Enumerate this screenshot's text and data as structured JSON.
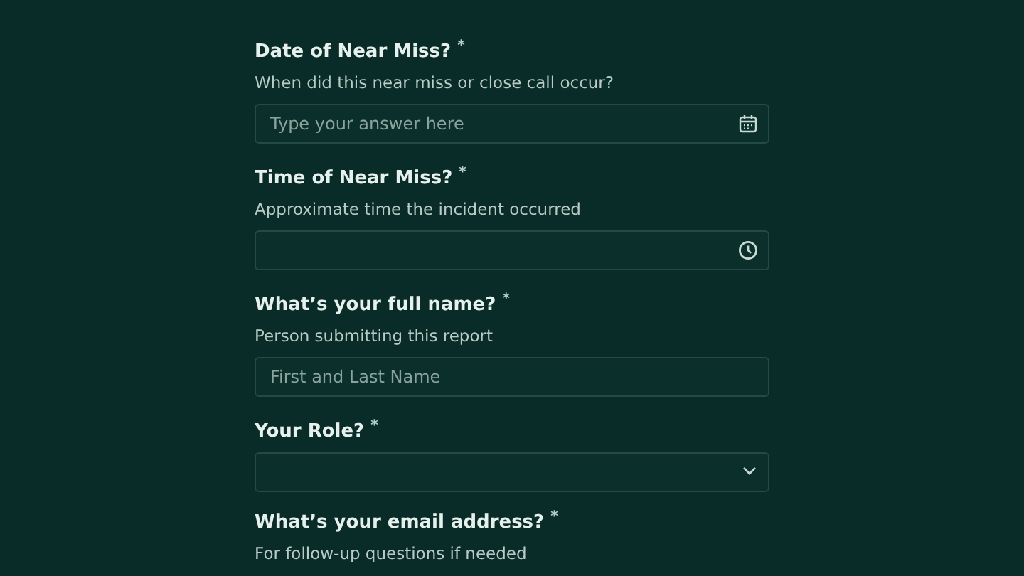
{
  "questions": [
    {
      "kind": "date",
      "label": "Date of Near Miss? $^{*}$",
      "help": "When did this near miss or close call occur?",
      "placeholder": "Type your answer here"
    },
    {
      "kind": "time",
      "label": "Time of Near Miss? $^{*}$",
      "help": "Approximate time the incident occurred"
    },
    {
      "kind": "text",
      "label": "What’s your full name? $^{*}$",
      "help": "Person submitting this report",
      "placeholder": "First and Last Name"
    },
    {
      "kind": "select",
      "label": "Your Role? $^{*}$"
    },
    {
      "kind": "none",
      "label": "What’s your email address? $^{*}$",
      "help": "For follow-up questions if needed"
    }
  ]
}
